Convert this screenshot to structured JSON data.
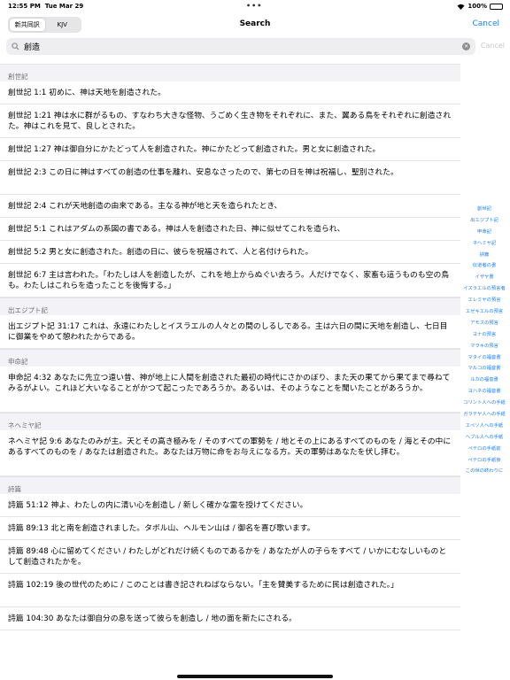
{
  "status": {
    "time": "12:55 PM",
    "date": "Tue Mar 29",
    "dots": "•••",
    "battery": "100%"
  },
  "nav": {
    "segments": [
      "新共同訳",
      "KJV"
    ],
    "active_segment": 0,
    "title": "Search",
    "cancel": "Cancel"
  },
  "search": {
    "value": "創造",
    "cancel": "Cancel"
  },
  "sections": [
    {
      "header": "創世記",
      "verses": [
        {
          "text": "創世記 1:1 初めに、神は天地を創造された。",
          "lines": 1
        },
        {
          "text": "創世記 1:21 神は水に群がるもの、すなわち大きな怪物、うごめく生き物をそれぞれに、また、翼ある鳥をそれぞれに創造された。神はこれを見て、良しとされた。",
          "lines": 2
        },
        {
          "text": "創世記 1:27 神は御自分にかたどって人を創造された。神にかたどって創造された。男と女に創造された。",
          "lines": 1
        },
        {
          "text": "創世記 2:3 この日に神はすべての創造の仕事を離れ、安息なさったので、第七の日を神は祝福し、聖別された。",
          "lines": 2
        },
        {
          "text": "創世記 2:4 これが天地創造の由来である。主なる神が地と天を造られたとき、",
          "lines": 1
        },
        {
          "text": "創世記 5:1 これはアダムの系図の書である。神は人を創造された日、神に似せてこれを造られ、",
          "lines": 1
        },
        {
          "text": "創世記 5:2 男と女に創造された。創造の日に、彼らを祝福されて、人と名付けられた。",
          "lines": 1
        },
        {
          "text": "創世記 6:7 主は言われた。「わたしは人を創造したが、これを地上からぬぐい去ろう。人だけでなく、家畜も這うものも空の鳥も。わたしはこれらを造ったことを後悔する。」",
          "lines": 2
        }
      ]
    },
    {
      "header": "出エジプト記",
      "verses": [
        {
          "text": "出エジプト記 31:17 これは、永遠にわたしとイスラエルの人々との間のしるしである。主は六日の間に天地を創造し、七日目に御業をやめて憩われたからである。",
          "lines": 2
        }
      ]
    },
    {
      "header": "申命記",
      "verses": [
        {
          "text": "申命記 4:32 あなたに先立つ遠い昔、神が地上に人間を創造された最初の時代にさかのぼり、また天の果てから果てまで尋ねてみるがよい。これほど大いなることがかつて起こったであろうか。あるいは、そのようなことを聞いたことがあろうか。",
          "lines": 3
        }
      ]
    },
    {
      "header": "ネヘミヤ記",
      "verses": [
        {
          "text": "ネヘミヤ記 9:6 あなたのみが主。天とその高き極みを / そのすべての軍勢を / 地とその上にあるすべてのものを / 海とその中にあるすべてのものを / あなたは創造された。あなたは万物に命をお与えになる方。天の軍勢はあなたを伏し拝む。",
          "lines": 3
        }
      ]
    },
    {
      "header": "詩篇",
      "verses": [
        {
          "text": "詩篇 51:12 神よ、わたしの内に清い心を創造し / 新しく確かな霊を授けてください。",
          "lines": 1
        },
        {
          "text": "詩篇 89:13 北と南を創造されました。タボル山、ヘルモン山は / 御名を喜び歌います。",
          "lines": 1
        },
        {
          "text": "詩篇 89:48 心に留めてください / わたしがどれだけ続くものであるかを / あなたが人の子らをすべて / いかにむなしいものとして創造されたかを。",
          "lines": 2
        },
        {
          "text": "詩篇 102:19 後の世代のために / このことは書き記されねばならない。「主を賛美するために民は創造された。」",
          "lines": 2
        },
        {
          "text": "詩篇 104:30 あなたは御自分の息を送って彼らを創造し / 地の面を新たにされる。",
          "lines": 1
        }
      ]
    }
  ],
  "index": [
    "創世記",
    "出エジプト記",
    "申命記",
    "ネヘミヤ記",
    "詩篇",
    "伝道者の書",
    "イザヤ書",
    "イスラエルの預言者",
    "エレミヤの預言",
    "エゼキエルの預言",
    "アモスの預言",
    "ヨナの預言",
    "マラキの預言",
    "マタイの福音書",
    "マルコの福音書",
    "ルカの福音書",
    "ヨハネの福音書",
    "コリント人への手紙",
    "ガラテヤ人への手紙",
    "エペソ人への手紙",
    "ヘブル人への手紙",
    "ペテロの手紙前",
    "ペテロの手紙後",
    "この世の終わりに"
  ]
}
